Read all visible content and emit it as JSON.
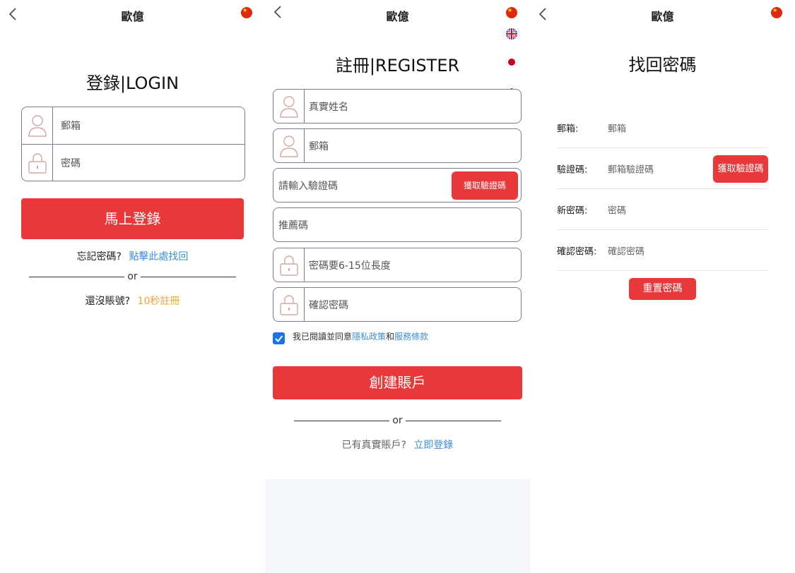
{
  "header": {
    "title": "歐億"
  },
  "login": {
    "title": "登錄|LOGIN",
    "email_placeholder": "郵箱",
    "password_placeholder": "密碼",
    "submit_label": "馬上登錄",
    "forgot_text": "忘記密碼?",
    "forgot_link": "點擊此處找回",
    "or_text": "or",
    "no_account_text": "還沒賬號?",
    "register_link": "10秒註冊"
  },
  "register": {
    "title": "註冊|REGISTER",
    "realname_placeholder": "真實姓名",
    "email_placeholder": "郵箱",
    "code_placeholder": "請輸入驗證碼",
    "get_code_label": "獲取驗證碼",
    "referral_placeholder": "推薦碼",
    "password_placeholder": "密碼要6-15位長度",
    "confirm_placeholder": "確認密碼",
    "agree_prefix": "我已閱讀並同意",
    "privacy_link": "隱私政策",
    "and_text": "和",
    "terms_link": "服務條款",
    "submit_label": "創建賬戶",
    "or_text": "or",
    "have_account_text": "已有真實賬戶?",
    "login_link": "立即登錄"
  },
  "reset": {
    "title": "找回密碼",
    "rows": [
      {
        "label": "郵箱:",
        "placeholder": "郵箱"
      },
      {
        "label": "驗證碼:",
        "placeholder": "郵箱驗證碼"
      },
      {
        "label": "新密碼:",
        "placeholder": "密碼"
      },
      {
        "label": "確認密碼:",
        "placeholder": "確認密碼"
      }
    ],
    "get_code_label": "獲取驗證碼",
    "submit_label": "重置密碼"
  },
  "language_flags": [
    "flag-china-icon",
    "flag-uk-icon",
    "flag-japan-icon",
    "flag-korea-icon"
  ],
  "colors": {
    "accent": "#e8383a",
    "link_blue": "#3d8ed8",
    "link_gold": "#f0a43a",
    "border": "#7c7c9c"
  }
}
